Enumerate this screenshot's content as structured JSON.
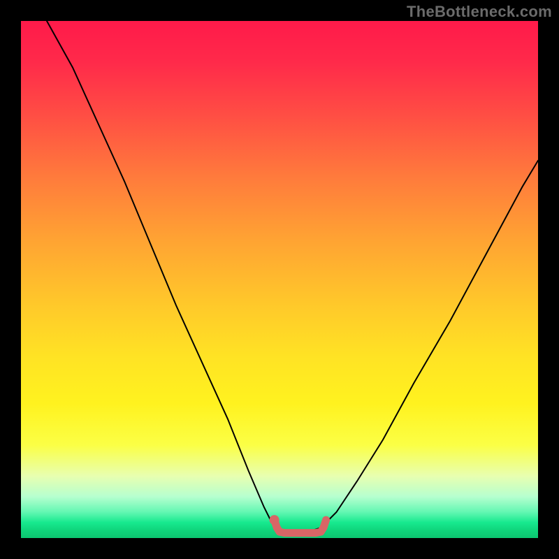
{
  "watermark": "TheBottleneck.com",
  "chart_data": {
    "type": "line",
    "title": "",
    "xlabel": "",
    "ylabel": "",
    "xlim": [
      0,
      100
    ],
    "ylim": [
      0,
      100
    ],
    "grid": false,
    "legend": false,
    "series": [
      {
        "name": "bottleneck-percentage-curve",
        "color": "#000000",
        "x": [
          5,
          10,
          15,
          20,
          25,
          30,
          35,
          40,
          44,
          47,
          49,
          51,
          53,
          55,
          58,
          61,
          65,
          70,
          76,
          83,
          90,
          97,
          100
        ],
        "values": [
          100,
          91,
          80,
          69,
          57,
          45,
          34,
          23,
          13,
          6,
          2,
          1,
          1,
          1,
          2,
          5,
          11,
          19,
          30,
          42,
          55,
          68,
          73
        ]
      },
      {
        "name": "optimal-zone-marker",
        "color": "#d86666",
        "x": [
          49,
          49.5,
          50,
          51,
          52,
          53,
          54,
          55,
          56,
          57,
          58,
          58.5,
          59
        ],
        "values": [
          3.5,
          2,
          1.2,
          1,
          1,
          1,
          1,
          1,
          1,
          1,
          1.2,
          2,
          3.5
        ]
      }
    ],
    "annotations": [
      {
        "type": "dot",
        "name": "optimal-start-dot",
        "x": 49,
        "y": 3.5,
        "color": "#d86666"
      }
    ],
    "background": "vertical-gradient red→yellow→green (bottleneck severity color scale)"
  }
}
